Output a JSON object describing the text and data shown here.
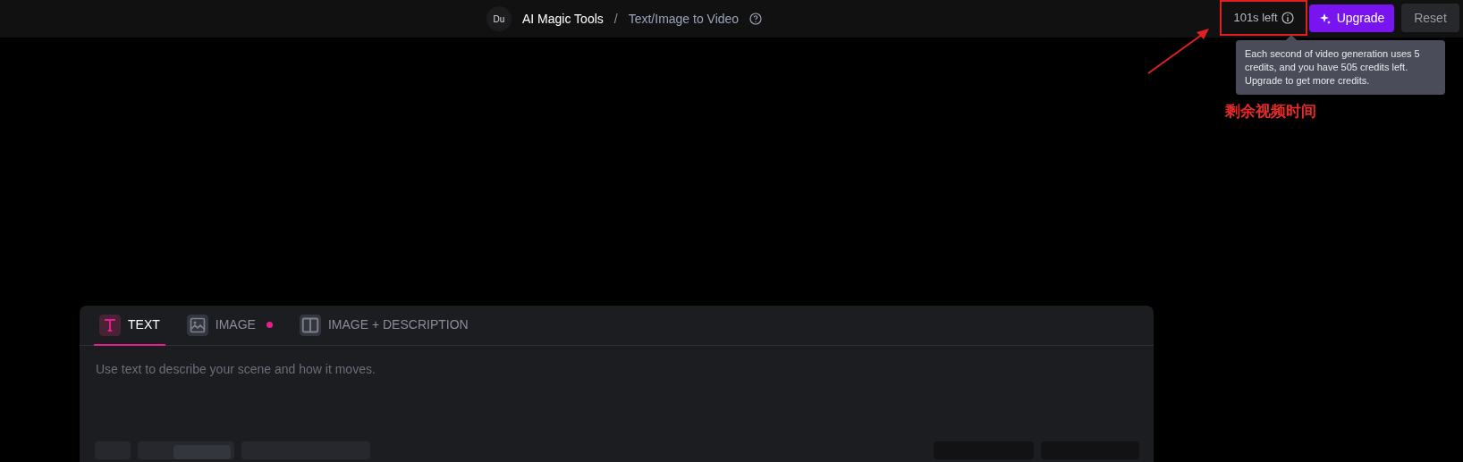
{
  "header": {
    "avatar": "Du",
    "breadcrumb": [
      "AI Magic Tools",
      "Text/Image to Video"
    ],
    "separator": "/",
    "time_left": "101s left",
    "upgrade": "Upgrade",
    "reset": "Reset"
  },
  "tooltip": "Each second of video generation uses 5 credits, and you have 505 credits left. Upgrade to get more credits.",
  "annotation": {
    "label": "剩余视频时间"
  },
  "prompt_panel": {
    "tabs": [
      {
        "label": "TEXT",
        "kind": "text",
        "selected": true,
        "dot": false
      },
      {
        "label": "IMAGE",
        "kind": "image",
        "selected": false,
        "dot": true
      },
      {
        "label": "IMAGE + DESCRIPTION",
        "kind": "split",
        "selected": false,
        "dot": false
      }
    ],
    "placeholder": "Use text to describe your scene and how it moves."
  }
}
